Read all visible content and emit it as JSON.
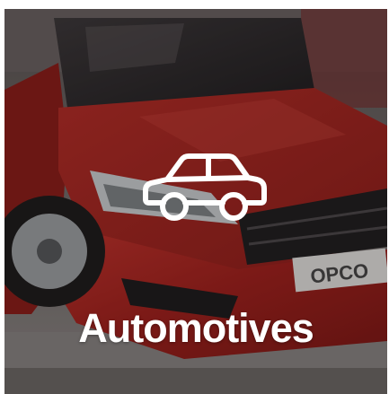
{
  "card": {
    "title": "Automotives",
    "icon": "car-icon",
    "plate_text": "OPCO"
  },
  "colors": {
    "overlay": "#141212",
    "title": "#ffffff",
    "car_body": "#b3201c"
  }
}
